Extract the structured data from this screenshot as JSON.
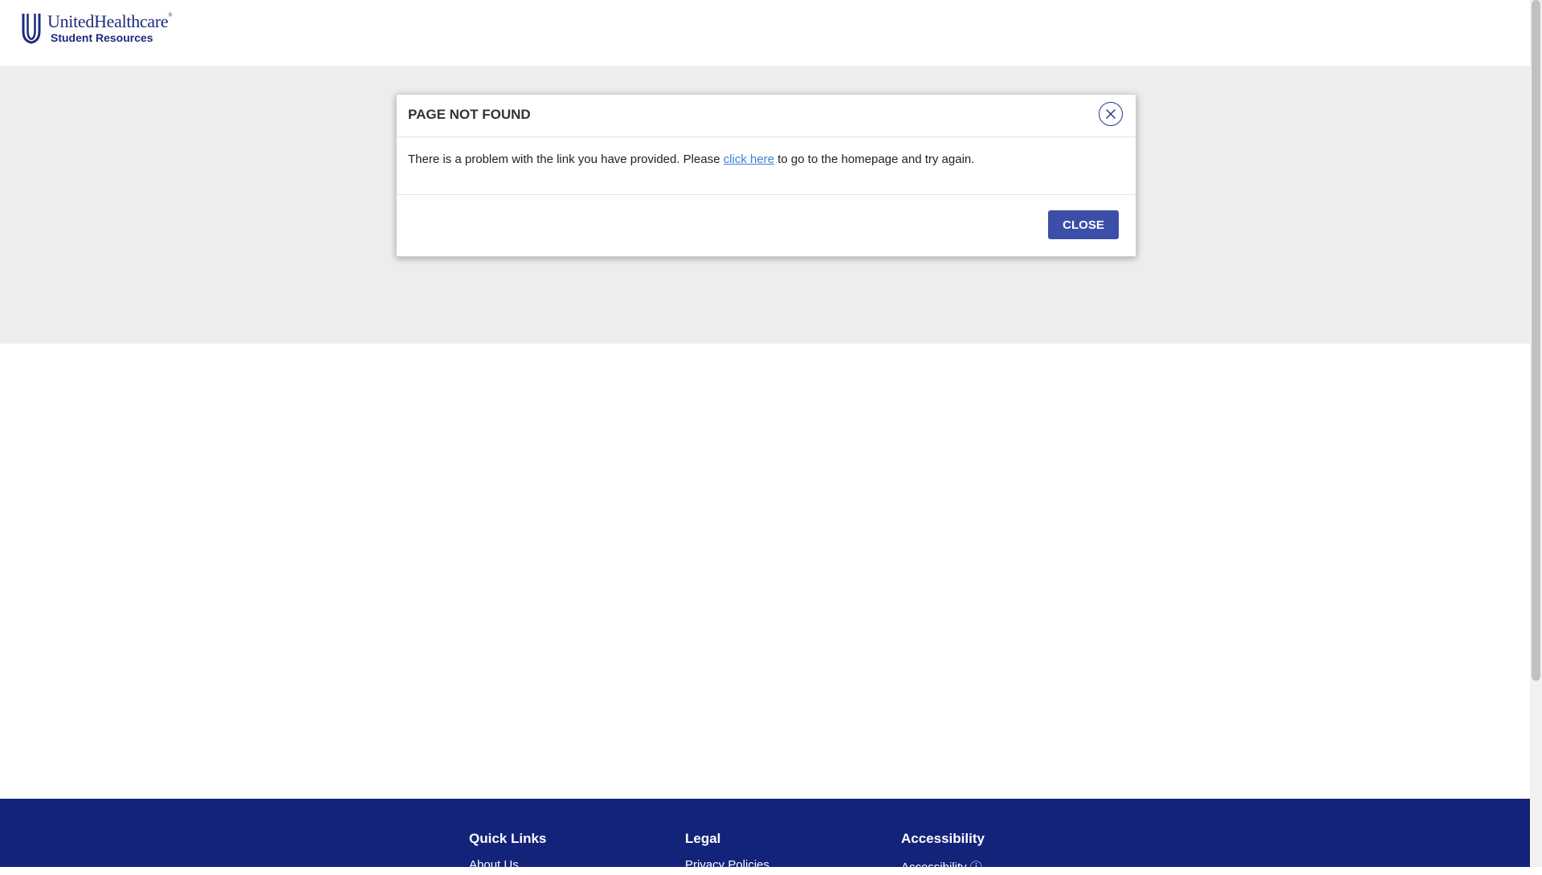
{
  "header": {
    "logo_brand": "UnitedHealthcare",
    "logo_sub": "Student Resources"
  },
  "modal": {
    "title": "PAGE NOT FOUND",
    "message_before": "There is a problem with the link you have provided. Please ",
    "link_text": "click here",
    "message_after": " to go to the homepage and try again.",
    "close_button": "CLOSE"
  },
  "footer": {
    "columns": [
      {
        "heading": "Quick Links",
        "link": "About Us"
      },
      {
        "heading": "Legal",
        "link": "Privacy Policies"
      },
      {
        "heading": "Accessibility",
        "link": "Accessibility ⓘ"
      }
    ]
  },
  "colors": {
    "brand_navy": "#14237a",
    "button_blue": "#3c4fa8",
    "link_blue": "#3d7fd6",
    "hero_gray": "#ededed"
  }
}
